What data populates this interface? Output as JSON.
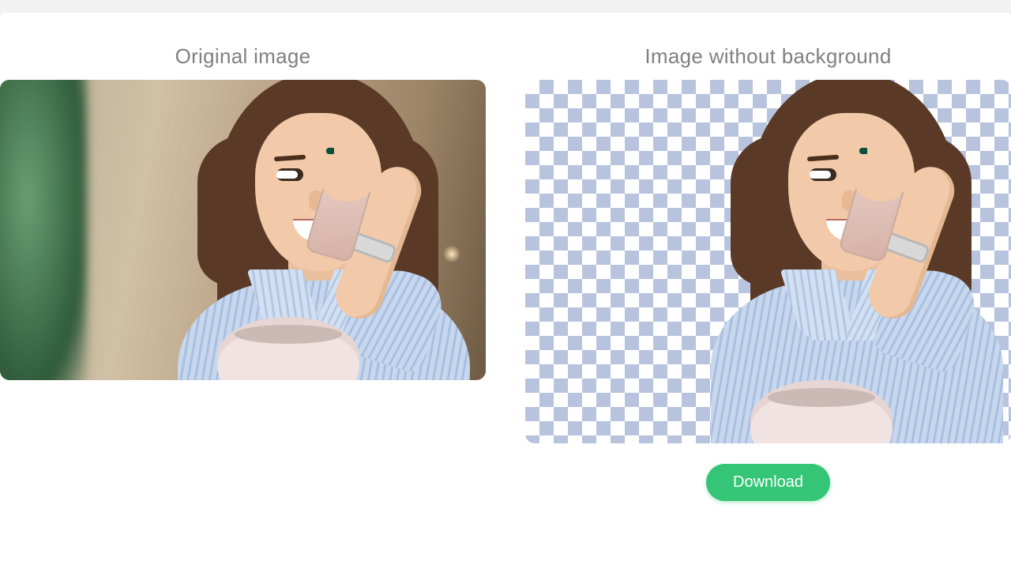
{
  "headings": {
    "original": "Original image",
    "removed": "Image without background"
  },
  "actions": {
    "download_label": "Download"
  },
  "colors": {
    "accent": "#34c576",
    "page_bg": "#f2f2f2",
    "heading_text": "#808080",
    "checker_light": "#ffffff",
    "checker_dark": "#b8c3de"
  }
}
